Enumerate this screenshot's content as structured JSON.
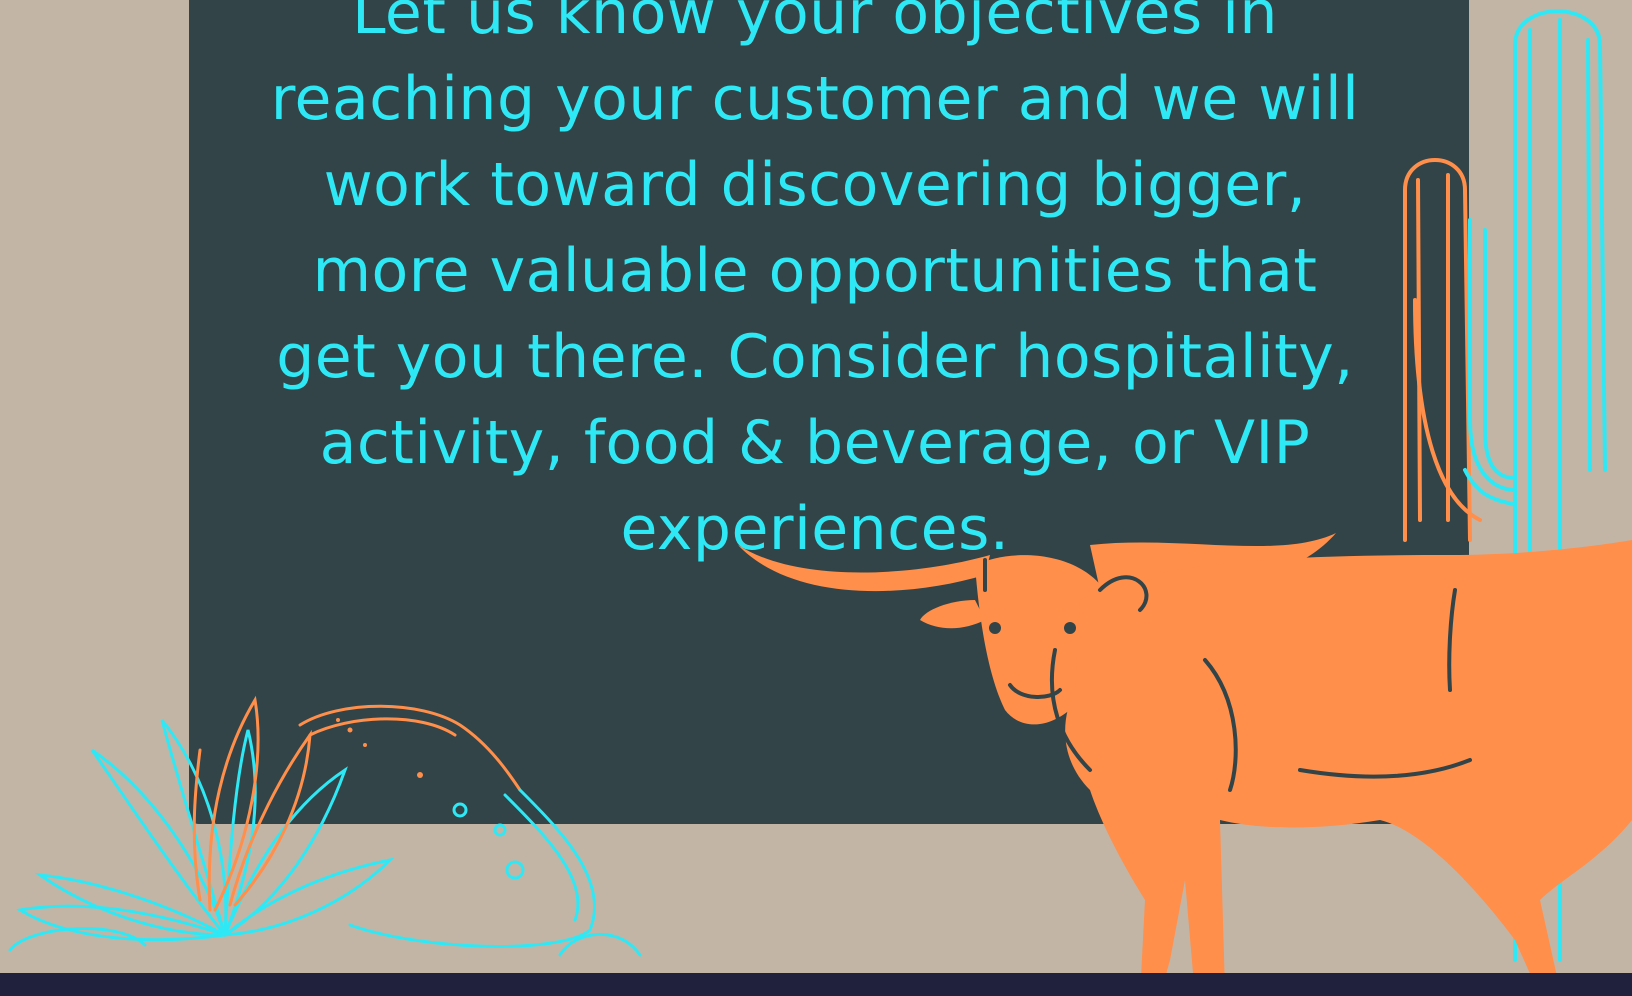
{
  "message_lines": [
    "Let us know your objectives in",
    "reaching your customer and we will",
    "work toward discovering bigger,",
    "more valuable opportunities that",
    "get you there. Consider hospitality,",
    "activity, food & beverage, or VIP",
    "experiences."
  ],
  "illustrations": {
    "longhorn": "longhorn-bull-icon",
    "cactus": "saguaro-cactus-icon",
    "agave": "agave-plant-icon",
    "rock": "boulder-icon"
  },
  "colors": {
    "background": "#c3b5a5",
    "panel": "#324447",
    "text": "#2ee9f5",
    "orange": "#ff8f4a",
    "footer": "#1f213d"
  }
}
